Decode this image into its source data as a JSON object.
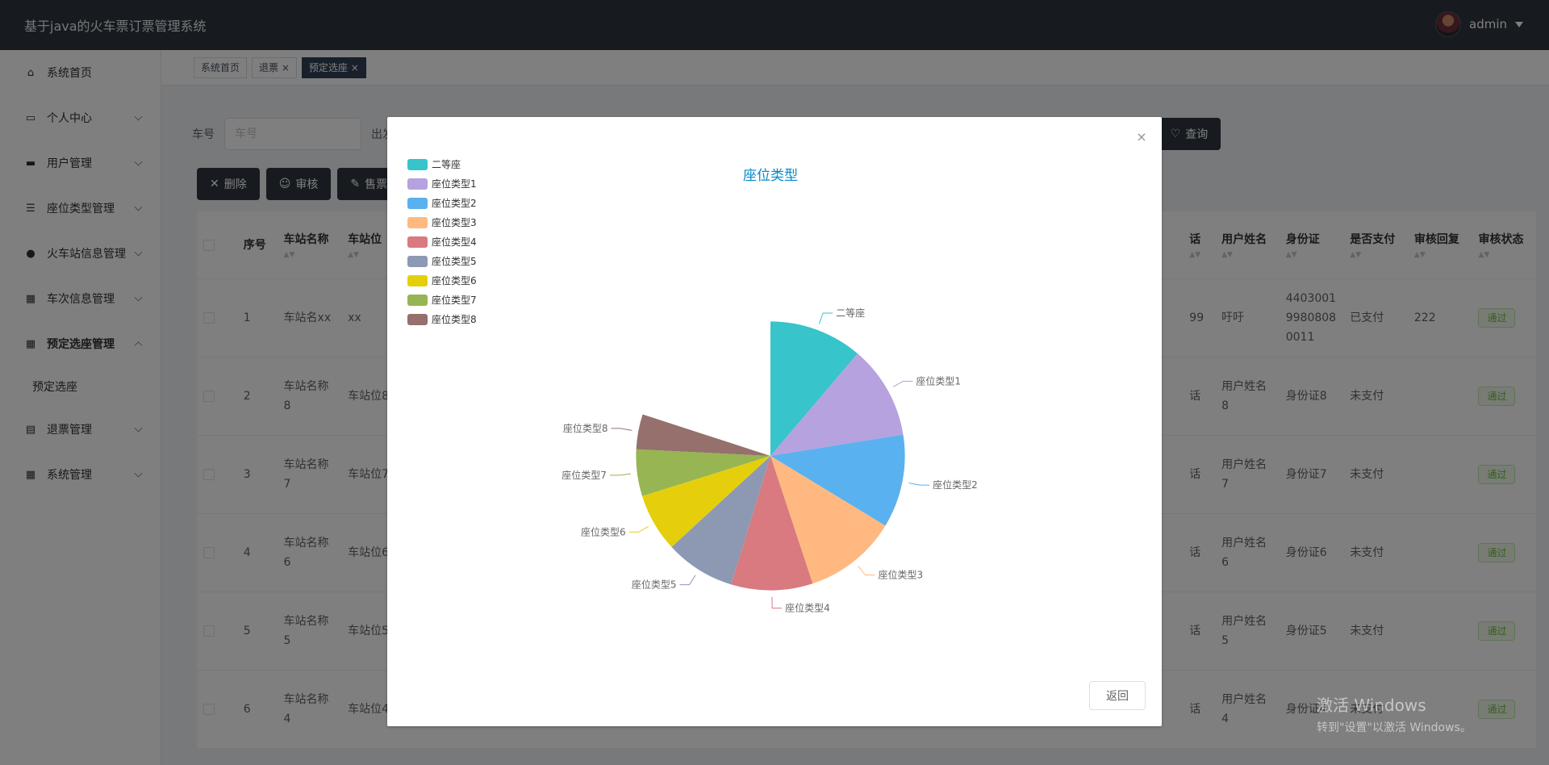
{
  "app": {
    "title": "基于java的火车票订票管理系统",
    "user": "admin"
  },
  "sidebar": {
    "items": [
      {
        "label": "系统首页",
        "icon": "home-icon",
        "expandable": false
      },
      {
        "label": "个人中心",
        "icon": "card-icon",
        "expandable": true
      },
      {
        "label": "用户管理",
        "icon": "monitor-icon",
        "expandable": true
      },
      {
        "label": "座位类型管理",
        "icon": "list-icon",
        "expandable": true
      },
      {
        "label": "火车站信息管理",
        "icon": "user-icon",
        "expandable": true
      },
      {
        "label": "车次信息管理",
        "icon": "grid-icon",
        "expandable": true
      },
      {
        "label": "预定选座管理",
        "icon": "grid-icon",
        "expandable": true,
        "open": true
      },
      {
        "label": "退票管理",
        "icon": "chart-icon",
        "expandable": true
      },
      {
        "label": "系统管理",
        "icon": "grid-icon",
        "expandable": true
      }
    ],
    "submenu": {
      "label": "预定选座"
    }
  },
  "tabs": [
    {
      "label": "系统首页",
      "closable": false,
      "active": false
    },
    {
      "label": "退票",
      "closable": true,
      "active": false
    },
    {
      "label": "预定选座",
      "closable": true,
      "active": true
    }
  ],
  "filters": {
    "train_label": "车号",
    "train_placeholder": "车号",
    "depart_label": "出发",
    "query_label": "查询"
  },
  "actions": {
    "delete": "删除",
    "review": "审核",
    "sell": "售票"
  },
  "table": {
    "left_headers": [
      "序号",
      "车站名称",
      "车站位"
    ],
    "right_headers": [
      "话",
      "用户姓名",
      "身份证",
      "是否支付",
      "审核回复",
      "审核状态"
    ],
    "rows": [
      {
        "no": "1",
        "station": "车站名xx",
        "pos": "xx",
        "phone": "99",
        "name": "吁吁",
        "idcard": "440300199808080011",
        "paid": "已支付",
        "reply": "222",
        "status": "通过"
      },
      {
        "no": "2",
        "station": "车站名称8",
        "pos": "车站位8",
        "phone": "话",
        "name": "用户姓名8",
        "idcard": "身份证8",
        "paid": "未支付",
        "reply": "",
        "status": "通过"
      },
      {
        "no": "3",
        "station": "车站名称7",
        "pos": "车站位7",
        "phone": "话",
        "name": "用户姓名7",
        "idcard": "身份证7",
        "paid": "未支付",
        "reply": "",
        "status": "通过"
      },
      {
        "no": "4",
        "station": "车站名称6",
        "pos": "车站位6",
        "phone": "话",
        "name": "用户姓名6",
        "idcard": "身份证6",
        "paid": "未支付",
        "reply": "",
        "status": "通过"
      },
      {
        "no": "5",
        "station": "车站名称5",
        "pos": "车站位5",
        "phone": "话",
        "name": "用户姓名5",
        "idcard": "身份证5",
        "paid": "未支付",
        "reply": "",
        "status": "通过"
      },
      {
        "no": "6",
        "station": "车站名称4",
        "pos": "车站位4",
        "phone": "话",
        "name": "用户姓名4",
        "idcard": "身份证4",
        "paid": "未支付",
        "reply": "",
        "status": "通过"
      }
    ]
  },
  "watermark": {
    "line1": "激活 Windows",
    "line2": "转到\"设置\"以激活 Windows。"
  },
  "dialog": {
    "back_label": "返回",
    "close_glyph": "×"
  },
  "chart_data": {
    "type": "pie",
    "rose": "radius",
    "title": "座位类型",
    "legend_position": "top-left",
    "categories": [
      "二等座",
      "座位类型1",
      "座位类型2",
      "座位类型3",
      "座位类型4",
      "座位类型5",
      "座位类型6",
      "座位类型7",
      "座位类型8"
    ],
    "values": [
      8,
      8,
      8,
      8,
      7,
      6,
      5,
      4,
      3
    ],
    "relative_radius": [
      0.98,
      0.98,
      0.98,
      0.98,
      0.98,
      0.98,
      0.98,
      0.98,
      0.98
    ],
    "colors": [
      "#37c4cb",
      "#b6a2de",
      "#5ab1ef",
      "#ffb980",
      "#d87a80",
      "#8d98b3",
      "#e5cf0d",
      "#97b552",
      "#95706d"
    ]
  }
}
